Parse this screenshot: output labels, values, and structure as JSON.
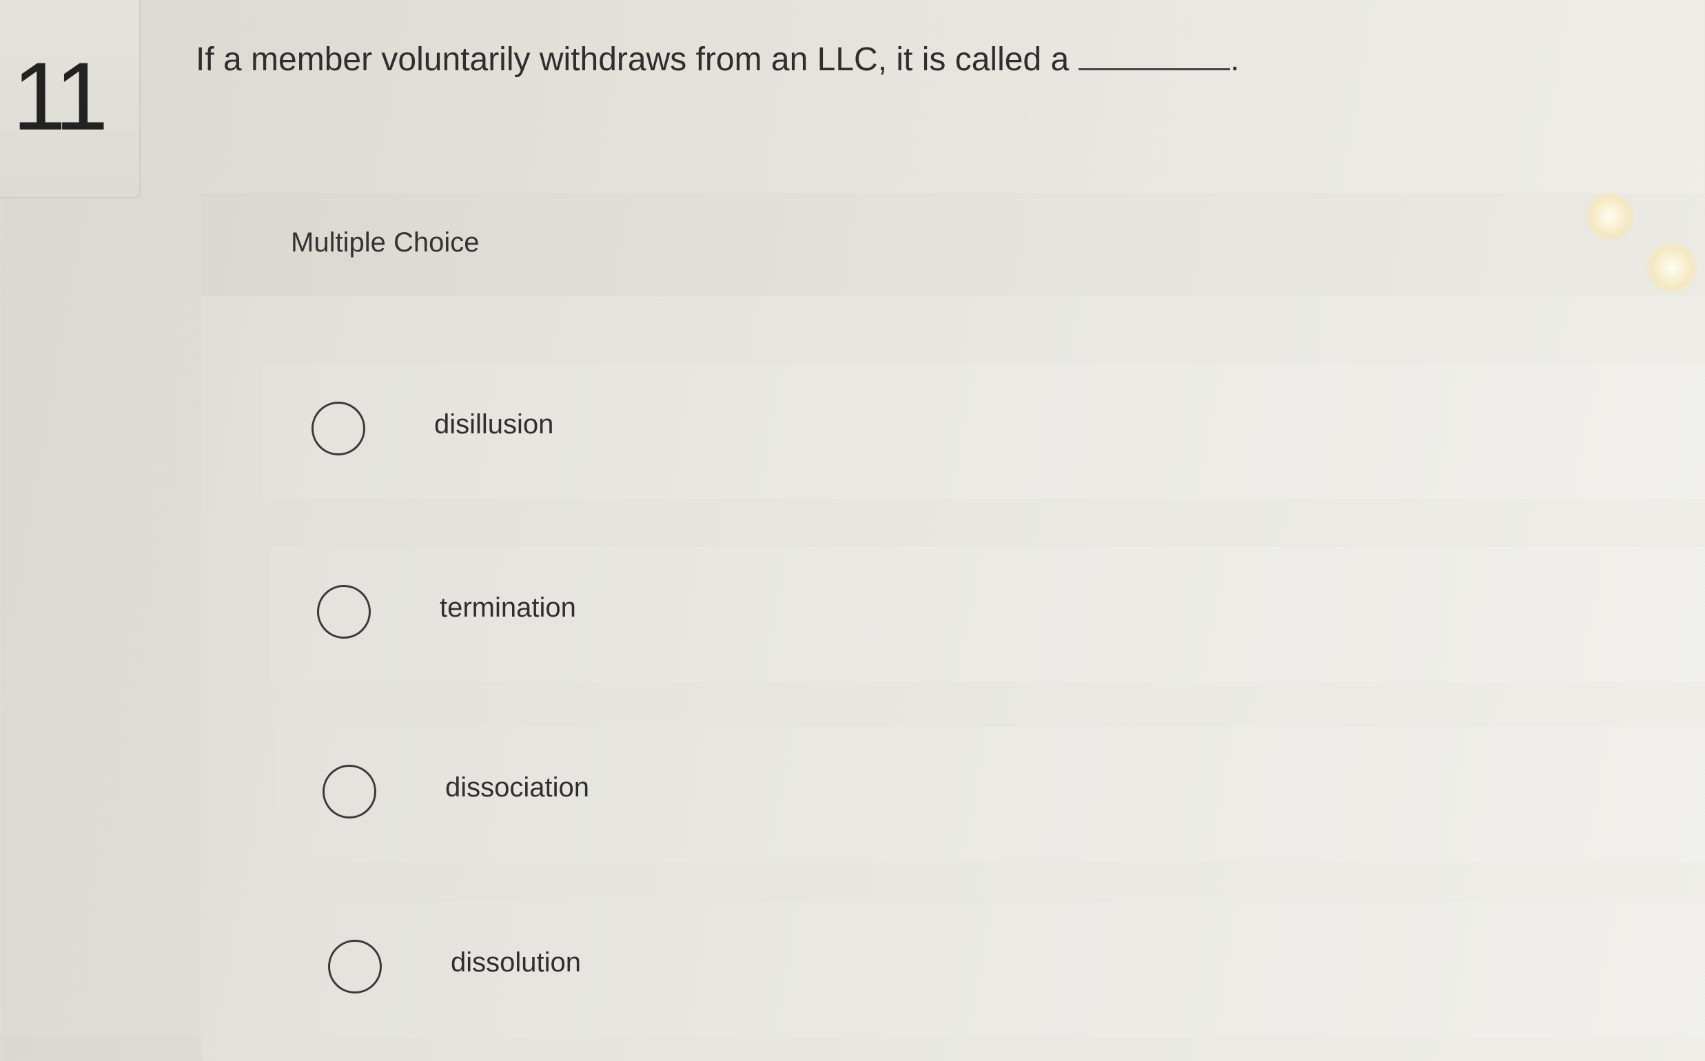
{
  "question": {
    "number": "11",
    "text": "If a member voluntarily withdraws from an LLC, it is called a",
    "terminal": "."
  },
  "panel": {
    "label": "Multiple Choice"
  },
  "options": [
    {
      "label": "disillusion"
    },
    {
      "label": "termination"
    },
    {
      "label": "dissociation"
    },
    {
      "label": "dissolution"
    }
  ],
  "colors": {
    "background": "#e4e3dc",
    "text": "#2e2e2e",
    "radio_border": "#3a3a3a"
  }
}
